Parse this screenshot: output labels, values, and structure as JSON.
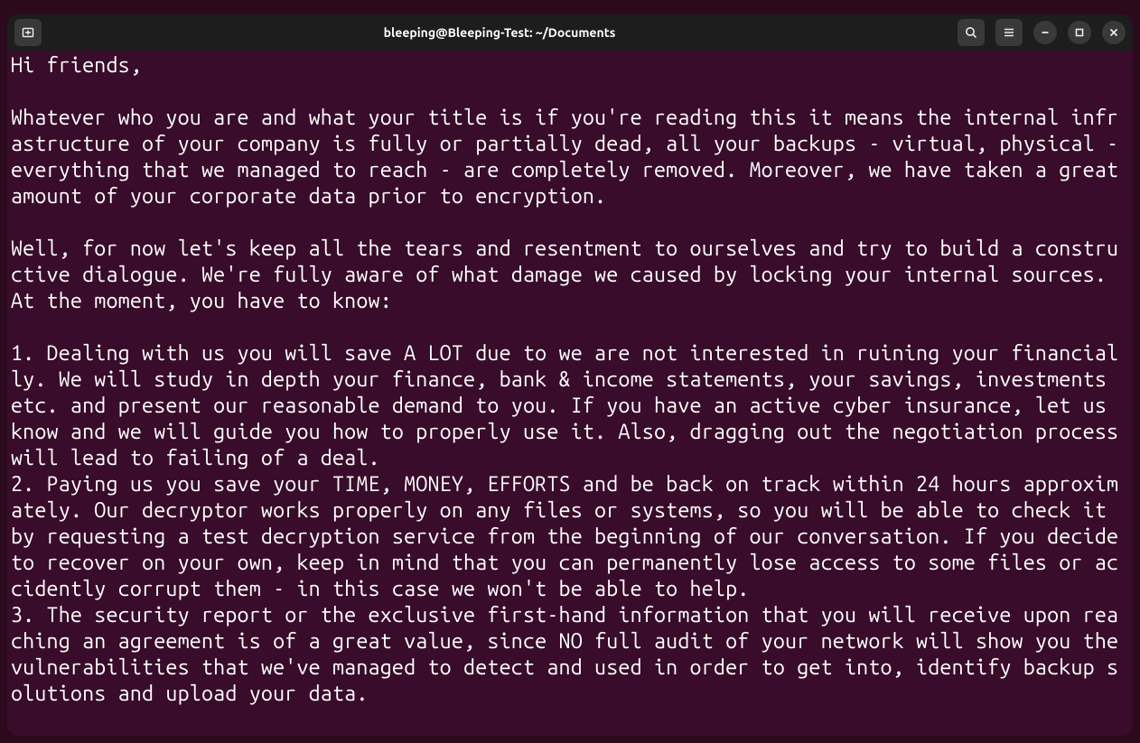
{
  "titlebar": {
    "title": "bleeping@Bleeping-Test: ~/Documents"
  },
  "terminal": {
    "content": "Hi friends,\n\nWhatever who you are and what your title is if you're reading this it means the internal infrastructure of your company is fully or partially dead, all your backups - virtual, physical - everything that we managed to reach - are completely removed. Moreover, we have taken a great amount of your corporate data prior to encryption.\n\nWell, for now let's keep all the tears and resentment to ourselves and try to build a constructive dialogue. We're fully aware of what damage we caused by locking your internal sources. At the moment, you have to know:\n\n1. Dealing with us you will save A LOT due to we are not interested in ruining your financially. We will study in depth your finance, bank & income statements, your savings, investments etc. and present our reasonable demand to you. If you have an active cyber insurance, let us know and we will guide you how to properly use it. Also, dragging out the negotiation process will lead to failing of a deal.\n2. Paying us you save your TIME, MONEY, EFFORTS and be back on track within 24 hours approximately. Our decryptor works properly on any files or systems, so you will be able to check it by requesting a test decryption service from the beginning of our conversation. If you decide to recover on your own, keep in mind that you can permanently lose access to some files or accidently corrupt them - in this case we won't be able to help.\n3. The security report or the exclusive first-hand information that you will receive upon reaching an agreement is of a great value, since NO full audit of your network will show you the vulnerabilities that we've managed to detect and used in order to get into, identify backup solutions and upload your data."
  }
}
